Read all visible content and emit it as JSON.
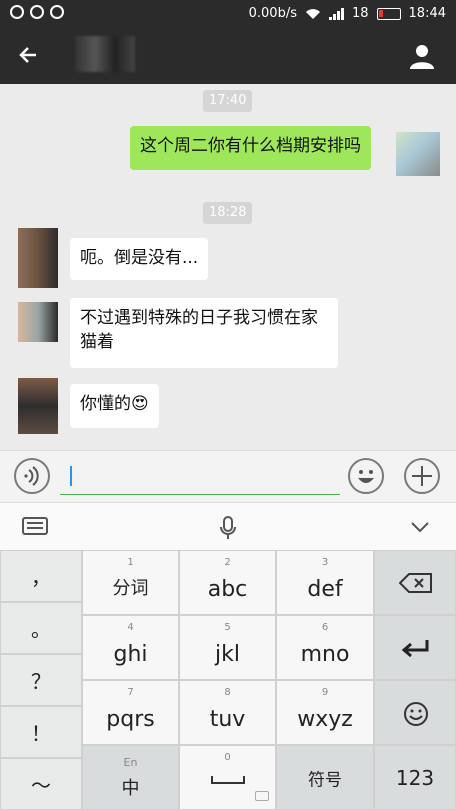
{
  "status_bar": {
    "network_speed": "0.00b/s",
    "battery_level": "18",
    "time": "18:44"
  },
  "header": {
    "back_icon": "back-arrow-icon",
    "profile_icon": "person-icon"
  },
  "chat": {
    "timestamps": [
      "17:40",
      "18:28"
    ],
    "messages": [
      {
        "from": "me",
        "text": "这个周二你有什么档期安排吗"
      },
      {
        "from": "other",
        "text": "呃。倒是没有..."
      },
      {
        "from": "other",
        "text": "不过遇到特殊的日子我习惯在家猫着"
      },
      {
        "from": "other",
        "text": "你懂的😍"
      }
    ]
  },
  "input_bar": {
    "voice_icon": "voice-icon",
    "emoji_icon": "emoji-icon",
    "plus_icon": "plus-icon",
    "value": ""
  },
  "keyboard": {
    "side_keys": [
      "，",
      "。",
      "？",
      "！",
      "～"
    ],
    "row1": [
      {
        "num": "1",
        "label": "分词"
      },
      {
        "num": "2",
        "label": "abc"
      },
      {
        "num": "3",
        "label": "def"
      }
    ],
    "row2": [
      {
        "num": "4",
        "label": "ghi"
      },
      {
        "num": "5",
        "label": "jkl"
      },
      {
        "num": "6",
        "label": "mno"
      }
    ],
    "row3": [
      {
        "num": "7",
        "label": "pqrs"
      },
      {
        "num": "8",
        "label": "tuv"
      },
      {
        "num": "9",
        "label": "wxyz"
      }
    ],
    "bottom": {
      "lang_small": "En",
      "lang_main": "中",
      "space_num": "0",
      "symbols": "符号",
      "numbers": "123"
    }
  }
}
